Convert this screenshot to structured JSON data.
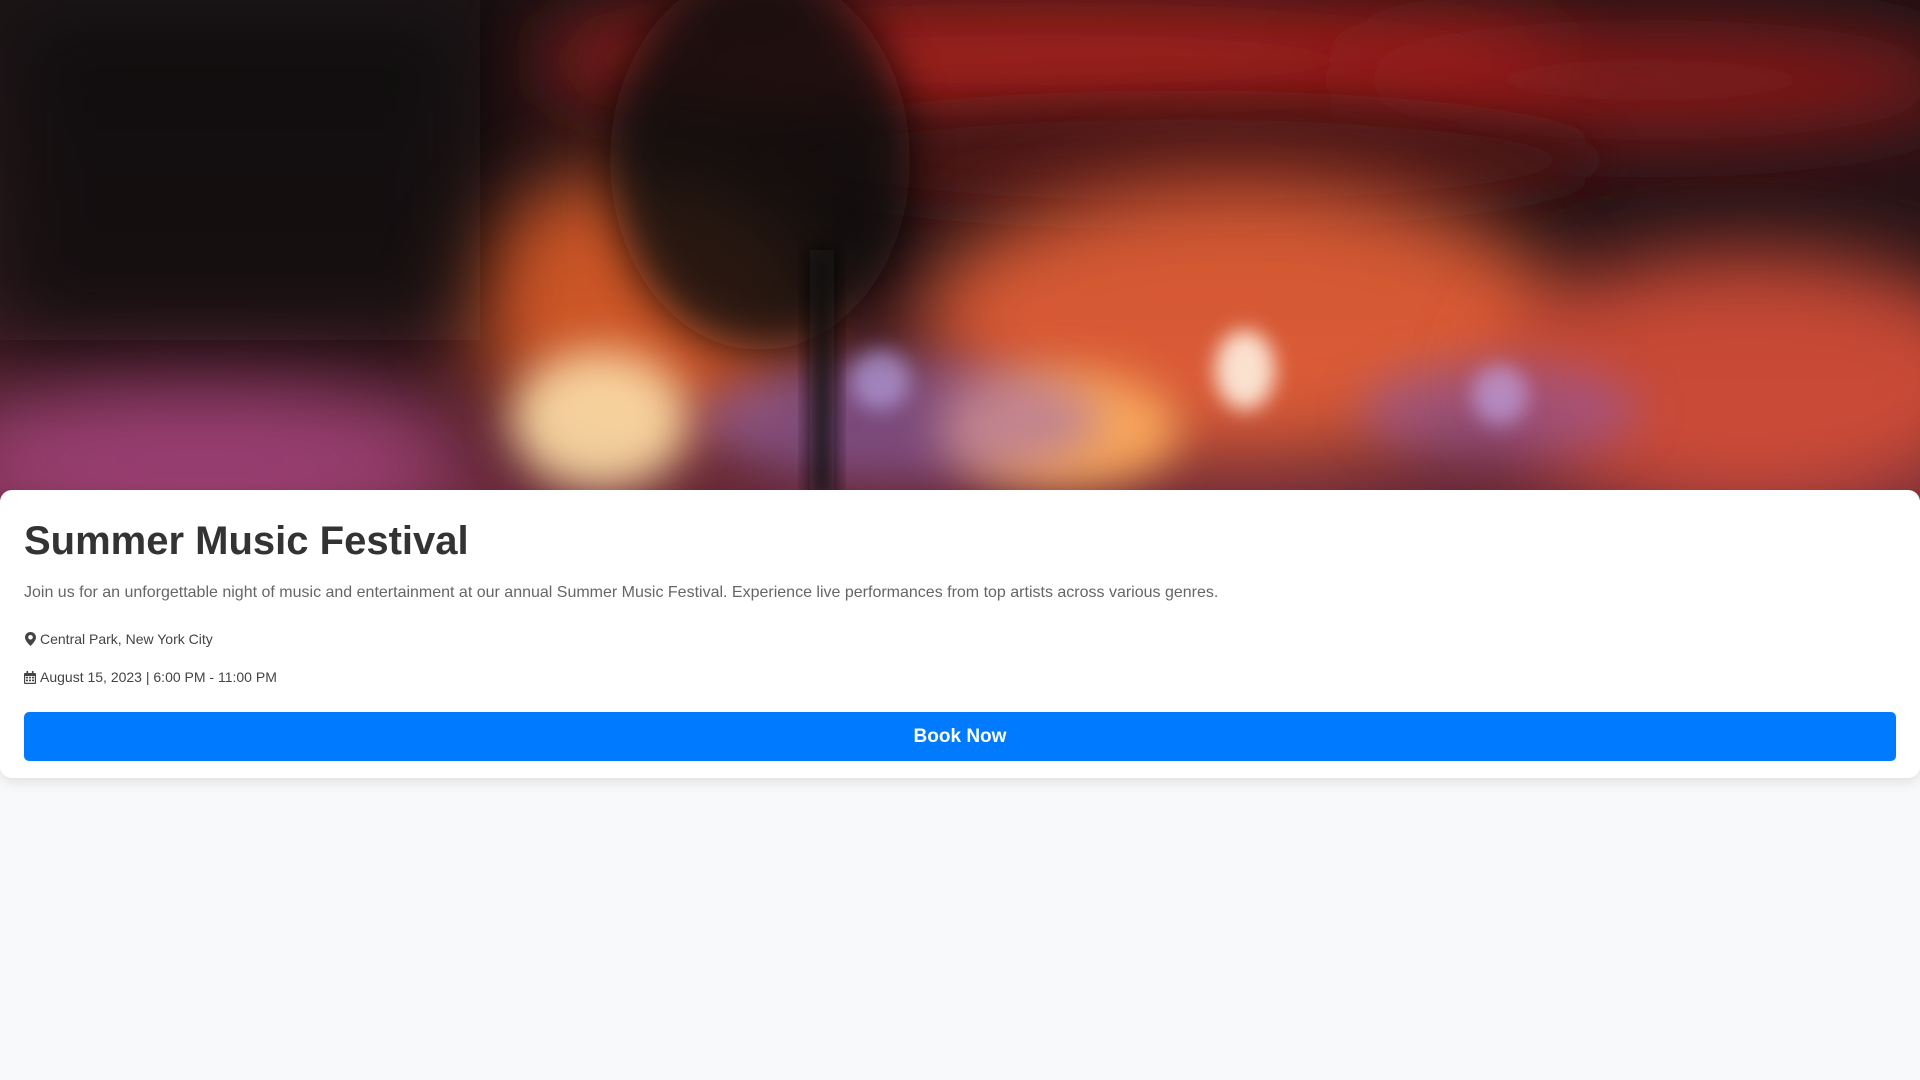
{
  "hero": {
    "image_description_icon": "concert-stage-image",
    "colors": [
      "#120d10",
      "#c0281e",
      "#ff7a3a",
      "#ffd9a0",
      "#d86aa8"
    ]
  },
  "event": {
    "title": "Summer Music Festival",
    "description": "Join us for an unforgettable night of music and entertainment at our annual Summer Music Festival. Experience live performances from top artists across various genres.",
    "location_icon": "map-marker-icon",
    "location": "Central Park, New York City",
    "date_icon": "calendar-icon",
    "datetime": "August 15, 2023 | 6:00 PM - 11:00 PM",
    "cta_label": "Book Now",
    "cta_color": "#007bff"
  }
}
